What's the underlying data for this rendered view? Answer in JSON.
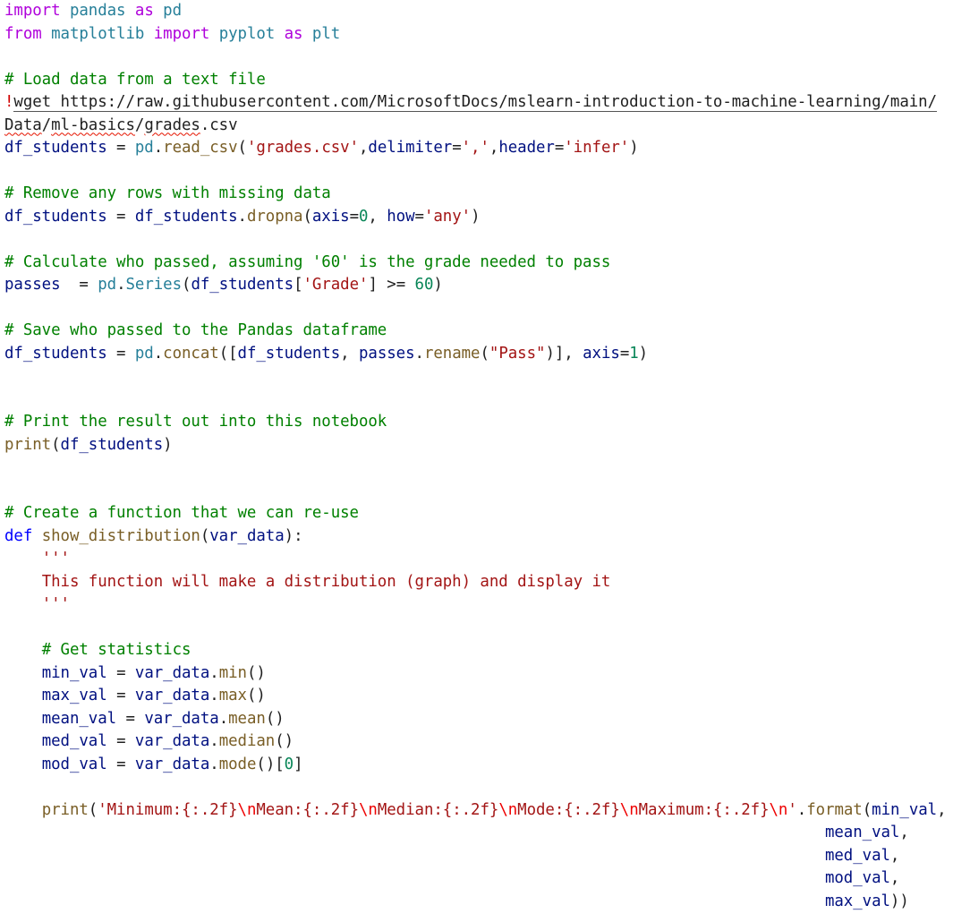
{
  "editor": {
    "language": "python",
    "colors": {
      "keyword": "#af00db",
      "def_keyword": "#0000ff",
      "module": "#267f99",
      "comment": "#008000",
      "string": "#a31515",
      "number": "#098658",
      "function": "#795e26",
      "variable": "#001080",
      "text": "#1f1f1f"
    },
    "lines": [
      "import pandas as pd",
      "from matplotlib import pyplot as plt",
      "",
      "# Load data from a text file",
      "!wget https://raw.githubusercontent.com/MicrosoftDocs/mslearn-introduction-to-machine-learning/main/",
      "Data/ml-basics/grades.csv",
      "df_students = pd.read_csv('grades.csv',delimiter=',',header='infer')",
      "",
      "# Remove any rows with missing data",
      "df_students = df_students.dropna(axis=0, how='any')",
      "",
      "# Calculate who passed, assuming '60' is the grade needed to pass",
      "passes  = pd.Series(df_students['Grade'] >= 60)",
      "",
      "# Save who passed to the Pandas dataframe",
      "df_students = pd.concat([df_students, passes.rename(\"Pass\")], axis=1)",
      "",
      "",
      "# Print the result out into this notebook",
      "print(df_students)",
      "",
      "",
      "# Create a function that we can re-use",
      "def show_distribution(var_data):",
      "    '''",
      "    This function will make a distribution (graph) and display it",
      "    '''",
      "",
      "    # Get statistics",
      "    min_val = var_data.min()",
      "    max_val = var_data.max()",
      "    mean_val = var_data.mean()",
      "    med_val = var_data.median()",
      "    mod_val = var_data.mode()[0]",
      "",
      "    print('Minimum:{:.2f}\\nMean:{:.2f}\\nMedian:{:.2f}\\nMode:{:.2f}\\nMaximum:{:.2f}\\n'.format(min_val,",
      "                                                                                        mean_val,",
      "                                                                                        med_val,",
      "                                                                                        mod_val,",
      "                                                                                        max_val))"
    ]
  }
}
